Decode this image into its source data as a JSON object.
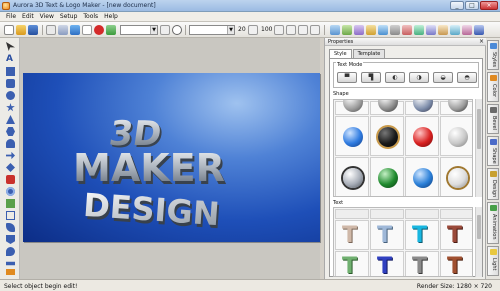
{
  "app": {
    "title": "Aurora 3D Text & Logo Maker - [new document]",
    "window_buttons": [
      "_",
      "□",
      "×"
    ]
  },
  "menu": [
    "File",
    "Edit",
    "View",
    "Setup",
    "Tools",
    "Help"
  ],
  "toolbar": {
    "font_size": "20",
    "zoom": "100"
  },
  "canvas": {
    "logo_lines": [
      "3D",
      "MAKER",
      "DESIGN"
    ]
  },
  "properties": {
    "title": "Properties",
    "close": "×",
    "tabs": [
      "Style",
      "Template"
    ],
    "text_mode_label": "Text Mode",
    "shape_label": "Shape",
    "text_label": "Text",
    "shape_balls": [
      "#2f7be0",
      "#1a1a1a",
      "#d82020",
      "#c8c8c8",
      "#a8aeb8",
      "#1f8a2e",
      "#2a7fd8",
      "#dddddd"
    ],
    "text_samples": [
      "#cfb8a8",
      "#9fb8d8",
      "#18b6e0",
      "#9a4a3a",
      "#70b070",
      "#3040c0",
      "#8a8a8a",
      "#a05030"
    ]
  },
  "side_tabs": [
    "Styles",
    "Color",
    "Bevel",
    "Shape",
    "Design",
    "Animation",
    "Light"
  ],
  "status": {
    "left": "Select object begin edit!",
    "right": "Render Size: 1280 × 720"
  }
}
